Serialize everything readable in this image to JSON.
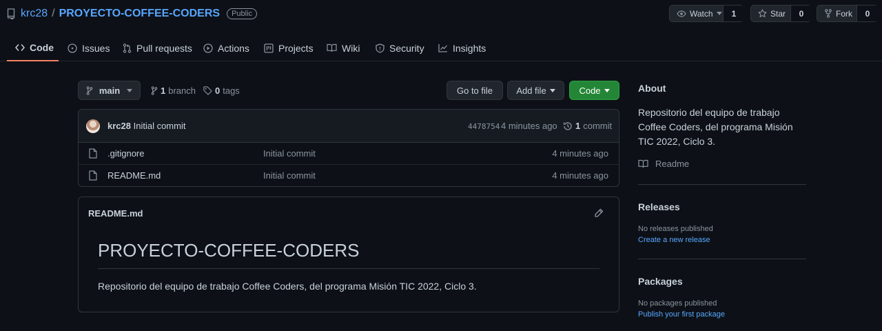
{
  "repo": {
    "owner": "krc28",
    "separator": "/",
    "name": "PROYECTO-COFFEE-CODERS",
    "visibility": "Public"
  },
  "actions": {
    "watch": {
      "label": "Watch",
      "count": "1"
    },
    "star": {
      "label": "Star",
      "count": "0"
    },
    "fork": {
      "label": "Fork",
      "count": "0"
    }
  },
  "tabs": [
    {
      "label": "Code",
      "icon": "code-icon",
      "active": true
    },
    {
      "label": "Issues",
      "icon": "issue-icon"
    },
    {
      "label": "Pull requests",
      "icon": "pull-request-icon"
    },
    {
      "label": "Actions",
      "icon": "play-icon"
    },
    {
      "label": "Projects",
      "icon": "project-icon"
    },
    {
      "label": "Wiki",
      "icon": "book-icon"
    },
    {
      "label": "Security",
      "icon": "shield-icon"
    },
    {
      "label": "Insights",
      "icon": "graph-icon"
    }
  ],
  "branch_bar": {
    "branch": "main",
    "branch_count": "1",
    "branch_word": "branch",
    "tag_count": "0",
    "tag_word": "tags",
    "go_to_file": "Go to file",
    "add_file": "Add file",
    "code": "Code"
  },
  "latest_commit": {
    "author": "krc28",
    "message": "Initial commit",
    "sha": "4478754",
    "time": "4 minutes ago",
    "commit_count": "1",
    "commit_word": "commit"
  },
  "files": [
    {
      "name": ".gitignore",
      "message": "Initial commit",
      "time": "4 minutes ago"
    },
    {
      "name": "README.md",
      "message": "Initial commit",
      "time": "4 minutes ago"
    }
  ],
  "readme": {
    "filename": "README.md",
    "heading": "PROYECTO-COFFEE-CODERS",
    "body": "Repositorio del equipo de trabajo Coffee Coders, del programa Misión TIC 2022, Ciclo 3."
  },
  "about": {
    "title": "About",
    "description_lines": [
      "Repositorio del equipo de trabajo",
      "Coffee Coders, del programa Misión",
      "TIC 2022, Ciclo 3."
    ],
    "readme_link": "Readme"
  },
  "releases": {
    "title": "Releases",
    "empty": "No releases published",
    "link": "Create a new release"
  },
  "packages": {
    "title": "Packages",
    "empty": "No packages published",
    "link": "Publish your first package"
  },
  "colors": {
    "background": "#0d1117",
    "link": "#58a6ff",
    "accent_tab": "#f78166",
    "primary_button": "#238636"
  }
}
